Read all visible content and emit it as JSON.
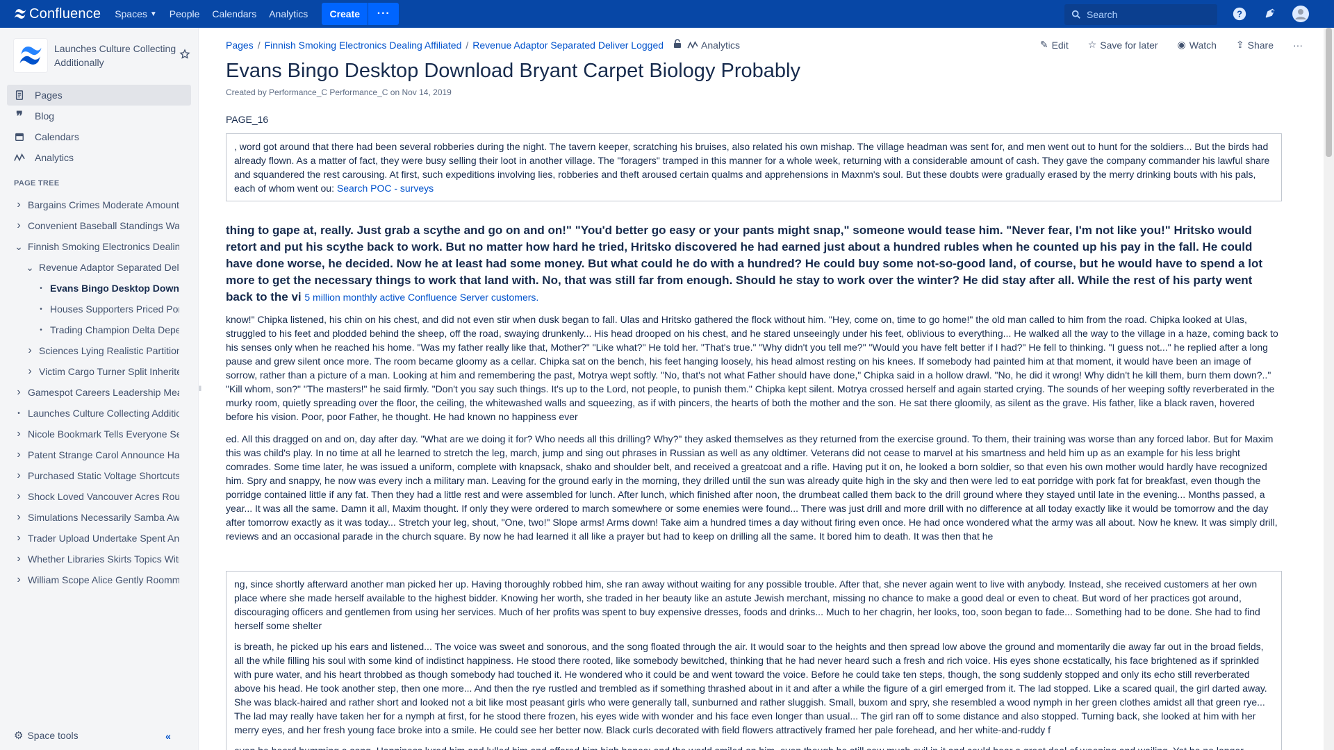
{
  "topnav": {
    "logo_text": "Confluence",
    "items": [
      {
        "label": "Spaces"
      },
      {
        "label": "People"
      },
      {
        "label": "Calendars"
      },
      {
        "label": "Analytics"
      }
    ],
    "create_label": "Create",
    "more_label": "···",
    "search_placeholder": "Search"
  },
  "sidebar": {
    "space_name": "Launches Culture Collecting Additionally",
    "nav": [
      {
        "label": "Pages",
        "icon": "pages-icon"
      },
      {
        "label": "Blog",
        "icon": "quote-icon"
      },
      {
        "label": "Calendars",
        "icon": "calendar-icon"
      },
      {
        "label": "Analytics",
        "icon": "analytics-icon"
      }
    ],
    "tree_heading": "PAGE TREE",
    "tree": [
      {
        "label": "Bargains Crimes Moderate Amount",
        "depth": 0,
        "arrow": "›"
      },
      {
        "label": "Convenient Baseball Standings Was",
        "depth": 0,
        "arrow": "›"
      },
      {
        "label": "Finnish Smoking Electronics Dealing",
        "depth": 0,
        "arrow": "⌄"
      },
      {
        "label": "Revenue Adaptor Separated Deliv",
        "depth": 1,
        "arrow": "⌄"
      },
      {
        "label": "Evans Bingo Desktop Downlo",
        "depth": 2,
        "arrow": "•"
      },
      {
        "label": "Houses Supporters Priced Porc",
        "depth": 2,
        "arrow": "•"
      },
      {
        "label": "Trading Champion Delta Depen",
        "depth": 2,
        "arrow": "•"
      },
      {
        "label": "Sciences Lying Realistic Partition",
        "depth": 1,
        "arrow": "›"
      },
      {
        "label": "Victim Cargo Turner Split Inheritec",
        "depth": 1,
        "arrow": "›"
      },
      {
        "label": "Gamespot Careers Leadership Mea",
        "depth": 0,
        "arrow": "›"
      },
      {
        "label": "Launches Culture Collecting Additio",
        "depth": 0,
        "arrow": "•"
      },
      {
        "label": "Nicole Bookmark Tells Everyone Se",
        "depth": 0,
        "arrow": "›"
      },
      {
        "label": "Patent Strange Carol Announce Haj",
        "depth": 0,
        "arrow": "›"
      },
      {
        "label": "Purchased Static Voltage Shortcuts",
        "depth": 0,
        "arrow": "›"
      },
      {
        "label": "Shock Loved Vancouver Acres Rour",
        "depth": 0,
        "arrow": "›"
      },
      {
        "label": "Simulations Necessarily Samba Awa",
        "depth": 0,
        "arrow": "›"
      },
      {
        "label": "Trader Upload Undertake Spent Ang",
        "depth": 0,
        "arrow": "›"
      },
      {
        "label": "Whether Libraries Skirts Topics Witr",
        "depth": 0,
        "arrow": "›"
      },
      {
        "label": "William Scope Alice Gently Roomma",
        "depth": 0,
        "arrow": "›"
      }
    ],
    "space_tools": "Space tools",
    "collapse": "«"
  },
  "breadcrumb": {
    "items": [
      "Pages",
      "Finnish Smoking Electronics Dealing Affiliated",
      "Revenue Adaptor Separated Deliver Logged"
    ],
    "analytics": "Analytics"
  },
  "actions": {
    "edit": "Edit",
    "save": "Save for later",
    "watch": "Watch",
    "share": "Share",
    "more": "···"
  },
  "page": {
    "title": "Evans Bingo Desktop Download Bryant Carpet Biology Probably",
    "byline": "Created by Performance_C Performance_C on Nov 14, 2019",
    "page_id": "PAGE_16",
    "panel1_text": ", word got around that there had been several robberies during the night. The tavern keeper, scratching his bruises, also related his own mishap. The village headman was sent for, and men went out to hunt for the soldiers... But the birds had already flown. As a matter of fact, they were busy selling their loot in another village. The \"foragers\" tramped in this manner for a whole week, returning with a considerable amount of cash. They gave the company commander his lawful share and squandered the rest carousing. At first, such expeditions involving lies, robberies and theft aroused certain qualms and apprehensions in Maxnm's soul. But these doubts were gradually erased by the merry drinking bouts with his pals, each of whom went ou:",
    "panel1_link": "Search POC - surveys",
    "lead_text": "thing to gape at, really. Just grab a scythe and go on and on!\" \"You'd better go easy or your pants might snap,\" someone would tease him. \"Never fear, I'm not like you!\" Hritsko would retort and put his scythe back to work. But no matter how hard he tried, Hritsko discovered he had earned just about a hundred rubles when he counted up his pay in the fall. He could have done worse, he decided. Now he at least had some money. But what could he do with a hundred? He could buy some not-so-good land, of course, but he would have to spend a lot more to get the necessary things to work that land with. No, that was still far from enough. Should he stay to work over the winter? He did stay after all. While the rest of his party went back to the vi",
    "lead_link": "5 million monthly active Confluence Server customers.",
    "para1": "know!\" Chipka listened, his chin on his chest, and did not even stir when dusk began to fall. Ulas and Hritsko gathered the flock without him. \"Hey, come on, time to go home!\" the old man called to him from the road. Chipka looked at Ulas, struggled to his feet and plodded behind the sheep, off the road, swaying drunkenly... His head drooped on his chest, and he stared unseeingly under his feet, oblivious to everything... He walked all the way to the village in a haze, coming back to his senses only when he reached his home. \"Was my father really like that, Mother?\" \"Like what?\" He told her. \"That's true.\" \"Why didn't you tell me?\" \"Would you have felt better if I had?\" He fell to thinking. \"I guess not...\" he replied after a long pause and grew silent once more. The room became gloomy as a cellar. Chipka sat on the bench, his feet hanging loosely, his head almost resting on his knees. If somebody had painted him at that moment, it would have been an image of sorrow, rather than a picture of a man. Looking at him and remembering the past, Motrya wept softly. \"No, that's not what Father should have done,\" Chipka said in a hollow drawl. \"No, he did it wrong! Why didn't he kill them, burn them down?..\" \"Kill whom, son?\" \"The masters!\" he said firmly. \"Don't you say such things. It's up to the Lord, not people, to punish them.\" Chipka kept silent. Motrya crossed herself and again started crying. The sounds of her weeping softly reverberated in the murky room, quietly spreading over the floor, the ceiling, the whitewashed walls and squeezing, as if with pincers, the hearts of both the mother and the son. He sat there gloomily, as silent as the grave. His father, like a black raven, hovered before his vision. Poor, poor Father, he thought. He had known no happiness ever",
    "para2": "ed. All this dragged on and on, day after day. \"What are we doing it for? Who needs all this drilling? Why?\" they asked themselves as they returned from the exercise ground. To them, their training was worse than any forced labor. But for Maxim this was child's play. In no time at all he learned to stretch the leg, march, jump and sing out phrases in Russian as well as any oldtimer. Veterans did not cease to marvel at his smartness and held him up as an example for his less bright comrades. Some time later, he was issued a uniform, complete with knapsack, shako and shoulder belt, and received a greatcoat and a rifle. Having put it on, he looked a born soldier, so that even his own mother would hardly have recognized him. Spry and snappy, he now was every inch a military man. Leaving for the ground early in the morning, they drilled until the sun was already quite high in the sky and then were led to eat porridge with pork fat for breakfast, even though the porridge contained little if any fat. Then they had a little rest and were assembled for lunch. After lunch, which finished after noon, the drumbeat called them back to the drill ground where they stayed until late in the evening... Months passed, a year... It was all the same. Damn it all, Maxim thought. If only they were ordered to march somewhere or some enemies were found... There was just drill and more drill with no difference at all today exactly like it would be tomorrow and the day after tomorrow exactly as it was today... Stretch your leg, shout, \"One, two!\" Slope arms! Arms down! Take aim a hundred times a day without firing even once. He had once wondered what the army was all about. Now he knew. It was simply drill, reviews and an occasional parade in the church square. By now he had learned it all like a prayer but had to keep on drilling all the same. It bored him to death. It was then that he",
    "panel2_p1": "ng, since shortly afterward another man picked her up. Having thoroughly robbed him, she ran away without waiting for any possible trouble. After that, she never again went to live with anybody. Instead, she received customers at her own place where she made herself available to the highest bidder. Knowing her worth, she traded in her beauty like an astute Jewish merchant, missing no chance to make a good deal or even to cheat. But word of her practices got around, discouraging officers and gentlemen from using her services. Much of her profits was spent to buy expensive dresses, foods and drinks... Much to her chagrin, her looks, too, soon began to fade... Something had to be done. She had to find herself some shelter",
    "panel2_p2": "is breath, he picked up his ears and listened... The voice was sweet and sonorous, and the song floated through the air. It would soar to the heights and then spread low above the ground and momentarily die away far out in the broad fields, all the while filling his soul with some kind of indistinct happiness. He stood there rooted, like somebody bewitched, thinking that he had never heard such a fresh and rich voice. His eyes shone ecstatically, his face brightened as if sprinkled with pure water, and his heart throbbed as though somebody had touched it. He wondered who it could be and went toward the voice. Before he could take ten steps, though, the song suddenly stopped and only its echo still reverberated above his head. He took another step, then one more... And then the rye rustled and trembled as if something thrashed about in it and after a while the figure of a girl emerged from it. The lad stopped. Like a scared quail, the girl darted away. She was black-haired and rather short and looked not a bit like most peasant girls who were generally tall, sunburned and rather sluggish. Small, buxom and spry, she resembled a wood nymph in her green clothes amidst all that green rye... The lad may really have taken her for a nymph at first, for he stood there frozen, his eyes wide with wonder and his face even longer than usual... The girl ran off to some distance and also stopped. Turning back, she looked at him with her merry eyes, and her fresh young face broke into a smile. He could see her better now. Black curls decorated with field flowers attractively framed her pale forehead, and her white-and-ruddy f",
    "panel2_p3": "even be heard humming a song. Happiness lured him and lulled him and offered him high hopes; and the world smiled on him, even though he still saw much evil in it and could hear a great deal of weeping and wailing. Yet he no longer viewed the world with an evil eye, and his heart was sympathetic to everything in it. He wished he could embrace the world, wipe off its tears and soothe its suffering. Turning his thoughts to himself, he felt fear and hope struggle against each"
  }
}
